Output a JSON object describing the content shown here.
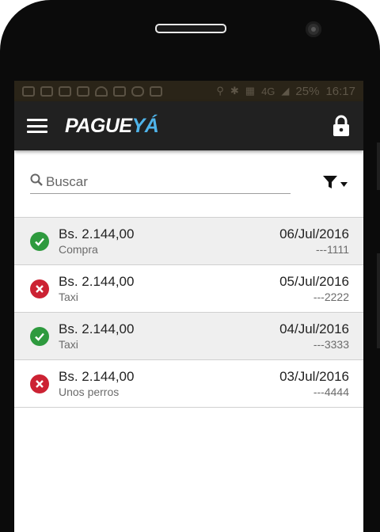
{
  "statusbar": {
    "battery": "25%",
    "time": "16:17",
    "network": "4G"
  },
  "app": {
    "logo_part1": "PAGUE",
    "logo_part2": "YÁ",
    "accent": "#4fb4ea"
  },
  "search": {
    "placeholder": "Buscar",
    "value": ""
  },
  "transactions": [
    {
      "status": "success",
      "amount": "Bs. 2.144,00",
      "description": "Compra",
      "date": "06/Jul/2016",
      "card": "---1111"
    },
    {
      "status": "failed",
      "amount": "Bs. 2.144,00",
      "description": "Taxi",
      "date": "05/Jul/2016",
      "card": "---2222"
    },
    {
      "status": "success",
      "amount": "Bs. 2.144,00",
      "description": "Taxi",
      "date": "04/Jul/2016",
      "card": "---3333"
    },
    {
      "status": "failed",
      "amount": "Bs. 2.144,00",
      "description": "Unos perros",
      "date": "03/Jul/2016",
      "card": "---4444"
    }
  ],
  "icons": {
    "menu": "menu-icon",
    "lock": "lock-icon",
    "search": "search-icon",
    "filter": "filter-icon",
    "success": "check-circle-icon",
    "failed": "x-circle-icon"
  },
  "colors": {
    "success": "#2e9a3e",
    "failed": "#cc2233",
    "appbar": "#212121"
  }
}
